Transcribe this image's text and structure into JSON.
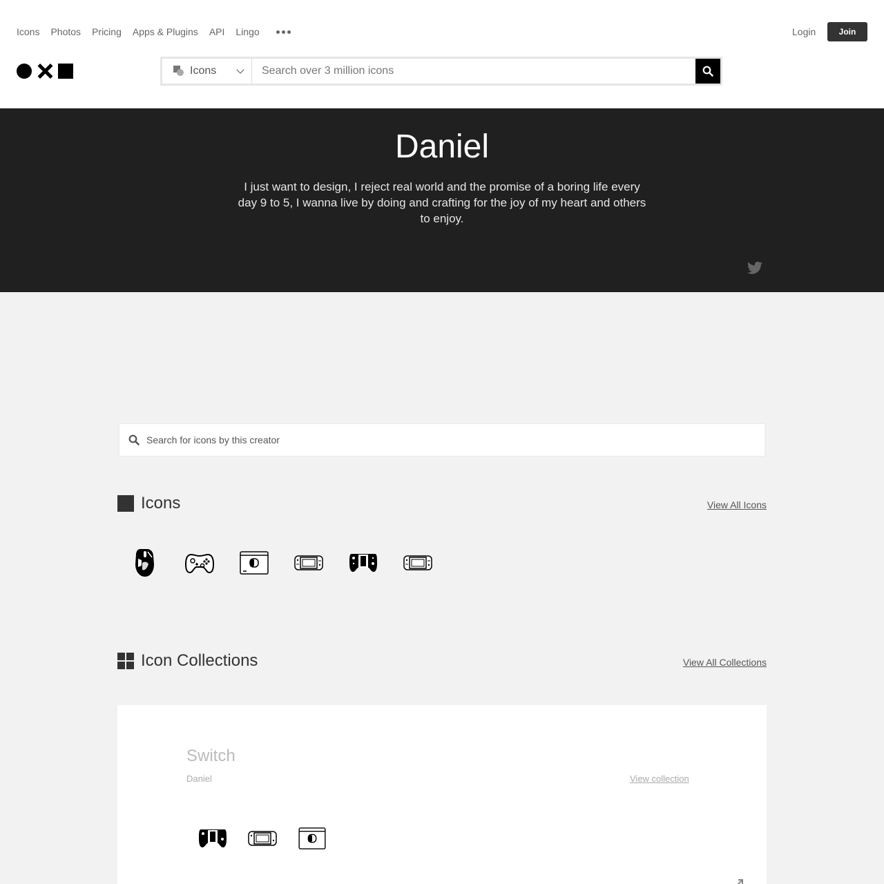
{
  "nav": {
    "links": [
      "Icons",
      "Photos",
      "Pricing",
      "Apps & Plugins",
      "API",
      "Lingo"
    ],
    "more_icon": "more-dots-icon",
    "login": "Login",
    "join": "Join"
  },
  "search": {
    "type_label": "Icons",
    "placeholder": "Search over 3 million icons"
  },
  "hero": {
    "name": "Daniel",
    "bio": "I just want to design, I reject real world and the promise of a boring life every day 9 to 5, I wanna live by doing and crafting for the joy of my heart and others to enjoy.",
    "social_icon": "twitter-icon"
  },
  "creator_search": {
    "placeholder": "Search for icons by this creator"
  },
  "icons_section": {
    "title": "Icons",
    "view_all": "View All Icons",
    "items": [
      "gaming-mouse-icon",
      "gamepad-icon",
      "switch-dock-icon",
      "switch-console-icon",
      "joycon-grip-icon",
      "switch-console-outline-icon"
    ]
  },
  "collections_section": {
    "title": "Icon Collections",
    "view_all": "View All Collections",
    "collection": {
      "title": "Switch",
      "author": "Daniel",
      "view": "View collection",
      "items": [
        "joycon-grip-icon",
        "switch-console-icon",
        "switch-dock-icon"
      ]
    }
  },
  "colors": {
    "hero_bg": "#202020",
    "page_bg": "#f2f2f2",
    "join_bg": "#333333"
  }
}
